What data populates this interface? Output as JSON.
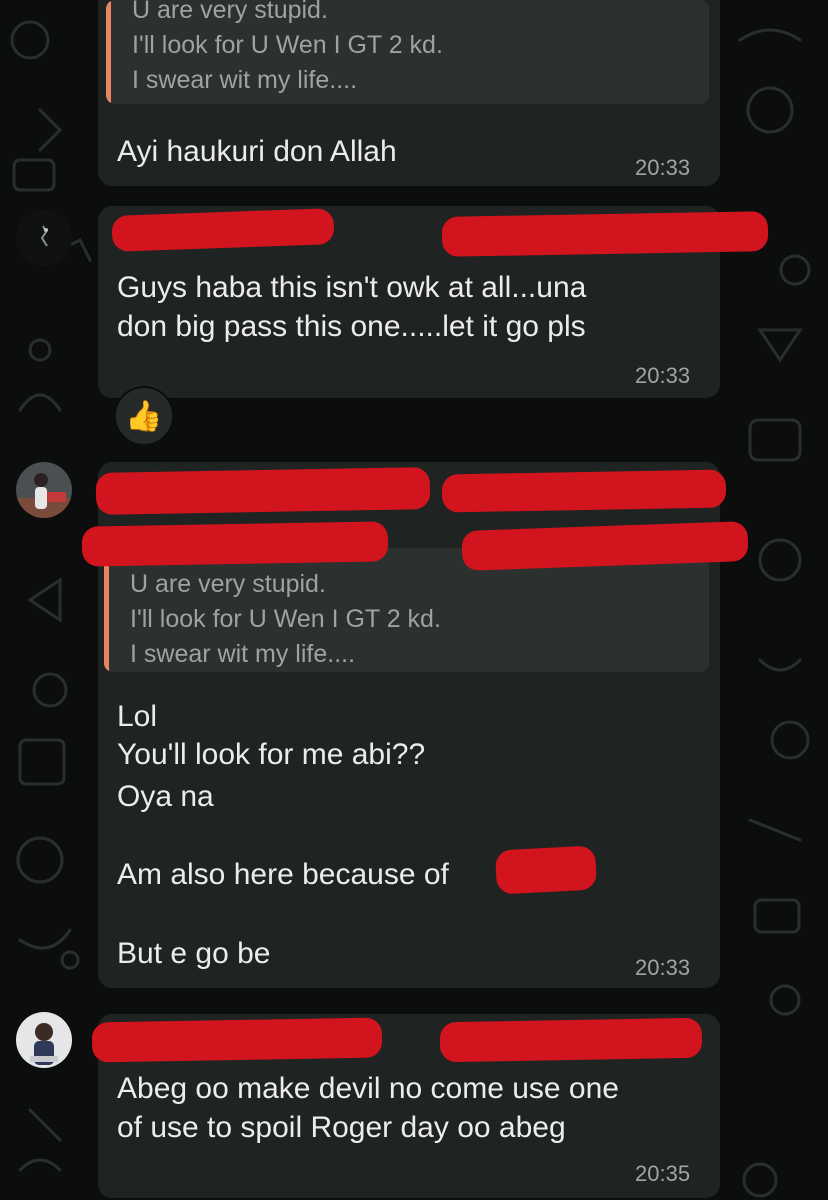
{
  "messages": [
    {
      "quote": {
        "lines": [
          "U are very stupid.",
          "I'll look for U Wen I GT 2 kd.",
          "I swear wit my life...."
        ]
      },
      "text_lines": [
        "Ayi haukuri don Allah"
      ],
      "time": "20:33"
    },
    {
      "sender": {
        "name": "[redacted]",
        "avatar_icon": "dark-avatar-icon"
      },
      "text_lines": [
        "Guys haba this isn't owk at all...una",
        "don big pass this one.....let it go pls"
      ],
      "time": "20:33",
      "reaction": {
        "emoji": "👍",
        "icon": "thumbs-up-icon"
      }
    },
    {
      "sender": {
        "name": "[redacted]",
        "avatar_icon": "person-avatar-icon"
      },
      "quote": {
        "lines": [
          "U are very stupid.",
          "I'll look for U Wen I GT 2 kd.",
          "I swear wit my life...."
        ]
      },
      "text_lines": [
        "Lol",
        "You'll look for me abi??",
        "Oya na",
        "",
        "Am also here because of",
        "",
        "But e go be"
      ],
      "time": "20:33"
    },
    {
      "sender": {
        "name": "[redacted]",
        "avatar_icon": "person-avatar-icon"
      },
      "text_lines": [
        "Abeg oo make devil no come use one",
        "of use to spoil Roger day oo abeg"
      ],
      "time": "20:35"
    }
  ],
  "colors": {
    "background": "#0c0e0d",
    "bubble": "#1f2321",
    "quote_bg": "#2c302e",
    "quote_bar": "#e9865f",
    "redaction": "#d2141e",
    "text": "#ececec",
    "timestamp": "#a0a5a2"
  }
}
